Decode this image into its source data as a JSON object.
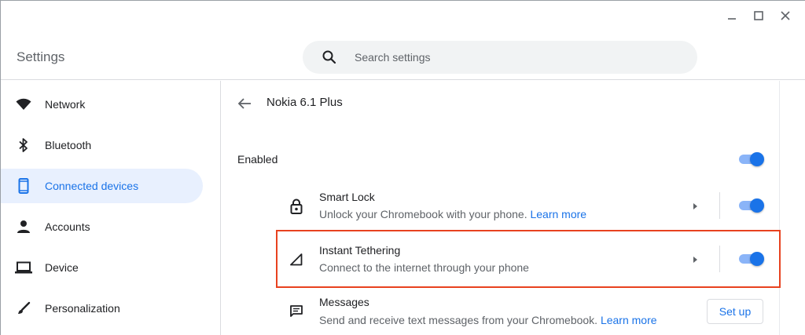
{
  "window": {
    "minimize_label": "Minimize",
    "maximize_label": "Maximize",
    "close_label": "Close"
  },
  "header": {
    "title": "Settings",
    "search": {
      "placeholder": "Search settings",
      "value": ""
    }
  },
  "sidebar": {
    "items": [
      {
        "label": "Network",
        "icon": "wifi-icon",
        "active": false
      },
      {
        "label": "Bluetooth",
        "icon": "bluetooth-icon",
        "active": false
      },
      {
        "label": "Connected devices",
        "icon": "phone-icon",
        "active": true
      },
      {
        "label": "Accounts",
        "icon": "person-icon",
        "active": false
      },
      {
        "label": "Device",
        "icon": "laptop-icon",
        "active": false
      },
      {
        "label": "Personalization",
        "icon": "brush-icon",
        "active": false
      }
    ]
  },
  "main": {
    "title": "Nokia 6.1 Plus",
    "enabled": {
      "label": "Enabled",
      "on": true
    },
    "features": [
      {
        "title": "Smart Lock",
        "description": "Unlock your Chromebook with your phone.",
        "link": "Learn more",
        "icon": "lock-icon",
        "on": true
      },
      {
        "title": "Instant Tethering",
        "description": "Connect to the internet through your phone",
        "link": "",
        "icon": "signal-icon",
        "on": true
      },
      {
        "title": "Messages",
        "description": "Send and receive text messages from your Chromebook.",
        "link": "Learn more",
        "icon": "message-icon",
        "button": "Set up"
      }
    ]
  },
  "colors": {
    "accent": "#1a73e8",
    "active_bg": "#e8f0fe",
    "highlight": "#e8421f",
    "toggle_track": "#8ab4f8"
  }
}
